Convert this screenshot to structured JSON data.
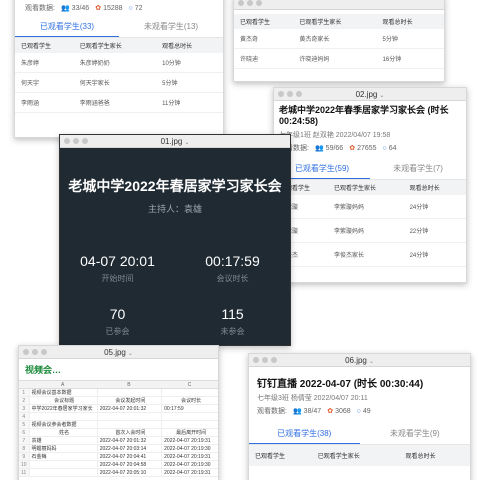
{
  "w1": {
    "stats_label": "观看数据:",
    "viewers": "33/46",
    "likes": "15288",
    "comments": "72",
    "tab_watched": "已观看学生(33)",
    "tab_unwatched": "未观看学生(13)",
    "headers": [
      "已观看学生",
      "已观看学生家长",
      "观看总时长"
    ],
    "rows": [
      [
        "朱彦婷",
        "朱彦婷奶奶",
        "10分钟"
      ],
      [
        "何天宇",
        "何天宇家长",
        "5分钟"
      ],
      [
        "李雨涵",
        "李雨涵爸爸",
        "11分钟"
      ]
    ]
  },
  "w2": {
    "headers": [
      "已观看学生",
      "已观看学生家长",
      "观看总时长"
    ],
    "rows": [
      [
        "黄杰奇",
        "黄杰奇家长",
        "5分钟"
      ],
      [
        "许晓迪",
        "许晓迪妈妈",
        "16分钟"
      ]
    ]
  },
  "w3": {
    "file": "02.jpg",
    "title": "老城中学2022年春季居家学习家长会 (时长 00:24:58)",
    "subtitle": "七年级1班 赵双艳 2022/04/07 19:58",
    "stats_label": "观看数据:",
    "viewers": "59/66",
    "likes": "27655",
    "comments": "64",
    "tab_watched": "已观看学生(59)",
    "tab_unwatched": "未观看学生(7)",
    "headers": [
      "已观看学生",
      "已观看学生家长",
      "观看总时长"
    ],
    "rows": [
      [
        "李紫璇",
        "李紫璇妈妈",
        "24分钟"
      ],
      [
        "李紫璇",
        "李紫璇妈妈",
        "22分钟"
      ],
      [
        "李俊杰",
        "李俊杰家长",
        "24分钟"
      ]
    ]
  },
  "w4": {
    "file": "01.jpg",
    "title": "老城中学2022年春居家学习家长会",
    "host": "主持人：袁雄",
    "start_time": "04-07 20:01",
    "start_label": "开始时间",
    "duration": "00:17:59",
    "duration_label": "会议时长",
    "attended": "70",
    "attended_label": "已参会",
    "absent": "115",
    "absent_label": "未参会"
  },
  "w5": {
    "file": "05.jpg",
    "app_title": "视频会…",
    "cols": [
      "A",
      "B",
      "C"
    ],
    "row_nums": [
      "1",
      "2",
      "3",
      "4",
      "5",
      "6",
      "7",
      "8",
      "9",
      "10",
      "11"
    ],
    "rows": [
      [
        "视频会议基本数据",
        "",
        ""
      ],
      [
        "会议标题",
        "会议发起时间",
        "会议时长"
      ],
      [
        "中学2022年春居家学习家长",
        "2022-04-07 20:01:32",
        "00:17:59"
      ],
      [
        "",
        "",
        ""
      ],
      [
        "视频会议参会者数据",
        "",
        ""
      ],
      [
        "姓名",
        "首次入会时间",
        "最后离开时间"
      ],
      [
        "袁雄",
        "2022-04-07 20:01:32",
        "2022-04-07 20:19:31"
      ],
      [
        "明媚丽妈妈",
        "2022-04-07 20:03:14",
        "2022-04-07 20:19:30"
      ],
      [
        "石金梅",
        "2022-04-07 20:04:41",
        "2022-04-07 20:19:31"
      ],
      [
        "",
        "2022-04-07 20:04:58",
        "2022-04-07 20:19:30"
      ],
      [
        "",
        "2022-04-07 20:05:10",
        "2022-04-07 20:19:31"
      ]
    ]
  },
  "w6": {
    "file": "06.jpg",
    "title": "钉钉直播 2022-04-07 (时长 00:30:44)",
    "subtitle": "七年级3班 杨倩莹 2022/04/07 20:11",
    "stats_label": "观看数据:",
    "viewers": "38/47",
    "likes": "3068",
    "comments": "49",
    "tab_watched": "已观看学生(38)",
    "tab_unwatched": "未观看学生(9)",
    "headers": [
      "已观看学生",
      "已观看学生家长",
      "观看总时长"
    ]
  },
  "icons": {
    "people": "people-icon",
    "flower": "flower-icon",
    "chat": "chat-icon",
    "chevron": "chevron-down-icon"
  }
}
